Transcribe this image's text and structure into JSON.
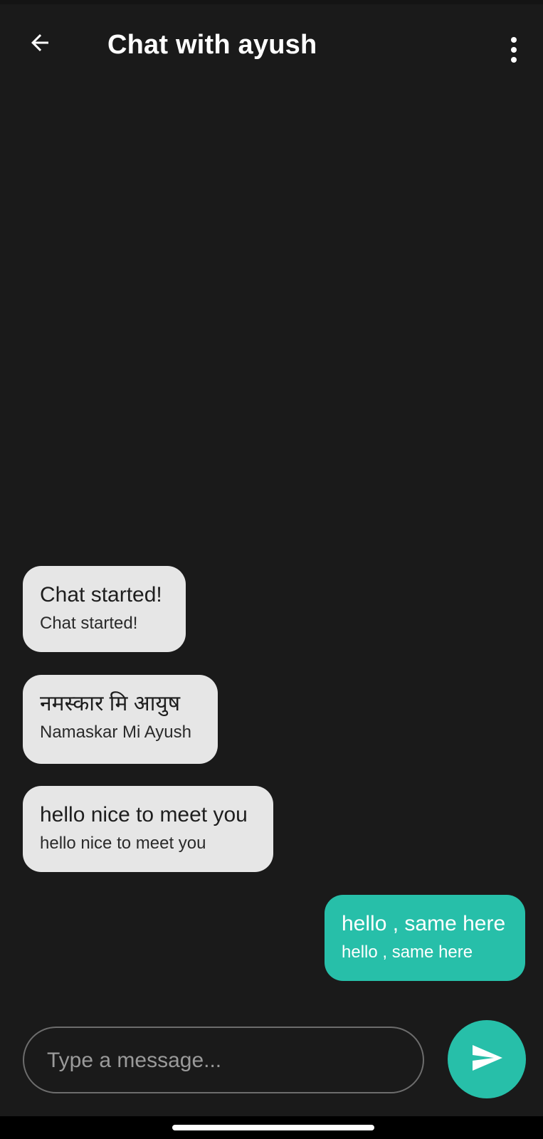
{
  "header": {
    "title": "Chat with ayush",
    "back_icon": "arrow-left-icon",
    "menu_icon": "more-vertical-icon"
  },
  "messages": [
    {
      "side": "incoming",
      "text": "Chat started!",
      "translation": "Chat started!"
    },
    {
      "side": "incoming",
      "text": "नमस्कार मि आयुष",
      "translation": "Namaskar Mi Ayush"
    },
    {
      "side": "incoming",
      "text": "hello nice to meet you",
      "translation": "hello nice to meet you"
    },
    {
      "side": "outgoing",
      "text": "hello , same here",
      "translation": "hello , same here"
    }
  ],
  "composer": {
    "placeholder": "Type a message...",
    "value": "",
    "send_icon": "send-icon"
  },
  "colors": {
    "background": "#1a1a1a",
    "incoming_bubble": "#e6e6e6",
    "outgoing_bubble": "#27bfa9",
    "accent": "#27bfa9"
  }
}
